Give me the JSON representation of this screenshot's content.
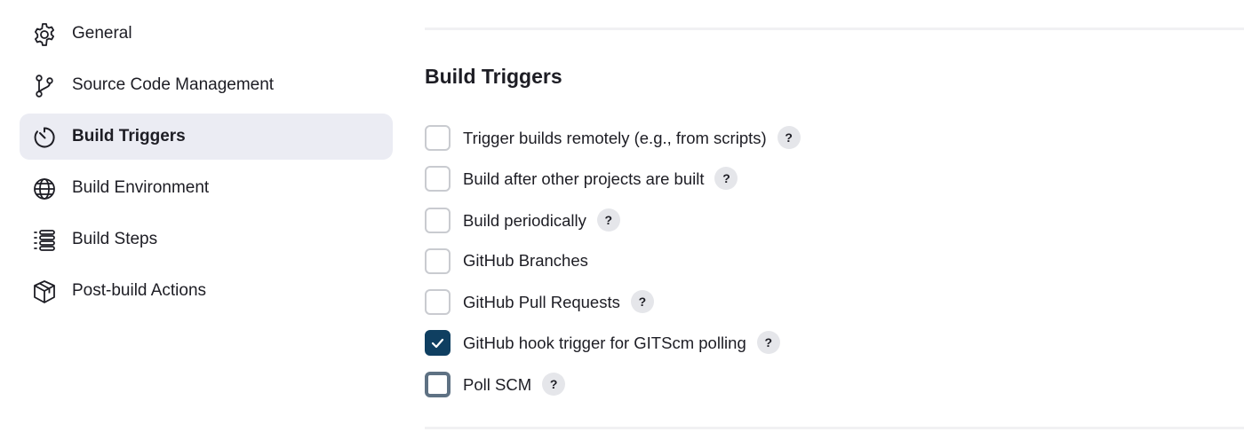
{
  "sidebar": {
    "items": [
      {
        "label": "General",
        "icon": "gear-icon",
        "active": false
      },
      {
        "label": "Source Code Management",
        "icon": "git-branch-icon",
        "active": false
      },
      {
        "label": "Build Triggers",
        "icon": "timer-icon",
        "active": true
      },
      {
        "label": "Build Environment",
        "icon": "globe-icon",
        "active": false
      },
      {
        "label": "Build Steps",
        "icon": "list-icon",
        "active": false
      },
      {
        "label": "Post-build Actions",
        "icon": "package-icon",
        "active": false
      }
    ]
  },
  "main": {
    "section_title": "Build Triggers",
    "triggers": [
      {
        "label": "Trigger builds remotely (e.g., from scripts)",
        "checked": false,
        "help": "?"
      },
      {
        "label": "Build after other projects are built",
        "checked": false,
        "help": "?"
      },
      {
        "label": "Build periodically",
        "checked": false,
        "help": "?"
      },
      {
        "label": "GitHub Branches",
        "checked": false,
        "help": null
      },
      {
        "label": "GitHub Pull Requests",
        "checked": false,
        "help": "?"
      },
      {
        "label": "GitHub hook trigger for GITScm polling",
        "checked": true,
        "help": "?"
      },
      {
        "label": "Poll SCM",
        "checked": false,
        "focused": true,
        "help": "?"
      }
    ]
  },
  "colors": {
    "active_nav_bg": "#ebecf3",
    "checkbox_checked": "#0f3f61",
    "checkbox_focus": "#5e7183",
    "help_badge_bg": "#e5e6ea"
  }
}
